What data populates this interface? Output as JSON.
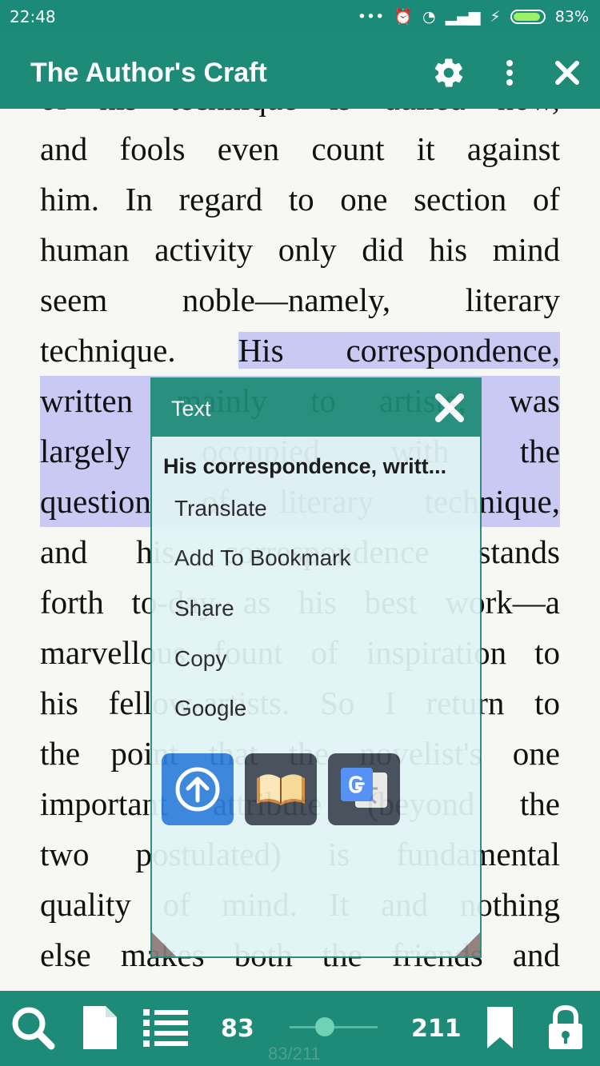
{
  "status": {
    "time": "22:48",
    "battery": "83%",
    "battery_level": 0.83
  },
  "appbar": {
    "title": "The Author's Craft"
  },
  "book": {
    "lines": [
      "of his technique is dulled now,",
      "and fools even count it against",
      "him. In regard to one section of",
      "human activity only did his mind",
      "seem noble—namely, literary",
      "technique. His correspondence,",
      "written mainly to artists, was",
      "largely occupied with the",
      "question of literary technique,",
      "and his correspondence stands",
      "forth to-day as his best work—a",
      "marvellous fount of inspiration to",
      "his fellow-artists. So I return to",
      "the point that the novelist's one",
      "important attribute (beyond the",
      "two postulated) is fundamental",
      "quality of mind. It and nothing",
      "else makes both the friends and"
    ],
    "highlight_start_text": "technique. ",
    "highlight_text": "His correspondence,"
  },
  "popup": {
    "title": "Text",
    "selected_text": "His correspondence, writt...",
    "menu": [
      "Translate",
      "Add To Bookmark",
      "Share",
      "Copy",
      "Google"
    ],
    "action_icons": [
      "share-upload-icon",
      "dictionary-book-icon",
      "google-translate-icon"
    ]
  },
  "bottom": {
    "current_page": "83",
    "total_pages": "211",
    "page_indicator": "83/211",
    "progress": 0.39
  },
  "colors": {
    "primary": "#1d8b77",
    "highlight": "#c9c9f3",
    "popup_bg": "#e1f4f6",
    "accent_blue": "#2f7fdc"
  }
}
